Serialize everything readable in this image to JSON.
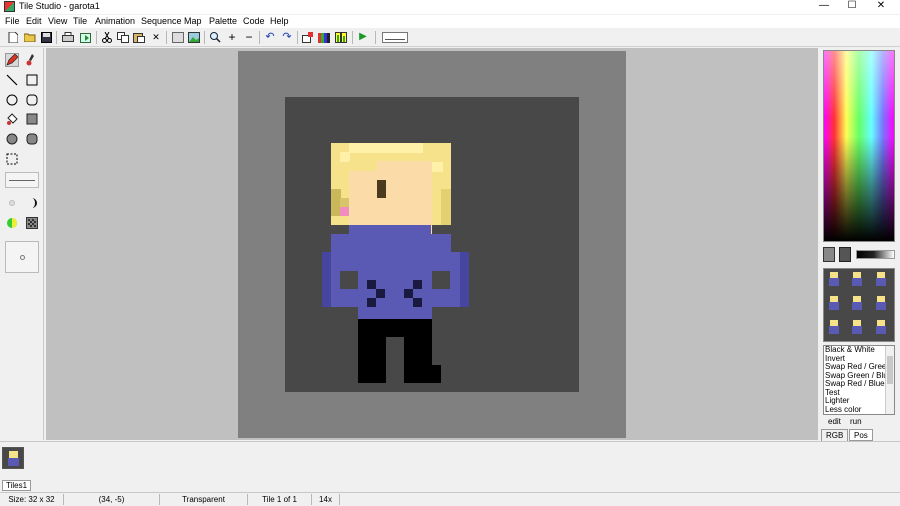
{
  "window": {
    "title": "Tile Studio - garota1",
    "controls": {
      "minimize": "—",
      "maximize": "☐",
      "close": "✕"
    }
  },
  "menu": [
    "File",
    "Edit",
    "View",
    "Tile",
    "Animation",
    "Sequence",
    "Map",
    "Palette",
    "Code",
    "Help"
  ],
  "toolbar": {
    "icons": [
      "new-file-icon",
      "open-folder-icon",
      "save-icon",
      "print-icon",
      "export-icon",
      "cut-icon",
      "copy-icon",
      "paste-icon",
      "delete-icon",
      "clear-icon",
      "import-image-icon",
      "zoom-icon",
      "zoom-in-icon",
      "zoom-out-icon",
      "undo-icon",
      "redo-icon",
      "tile-icon",
      "palette-icon",
      "bars-icon",
      "run-icon"
    ],
    "glyphs": {
      "zoom_in": "+",
      "zoom_out": "−",
      "undo": "↶",
      "redo": "↷",
      "run": "▶",
      "delete": "✕"
    }
  },
  "tools": [
    "pencil",
    "brush",
    "line",
    "rectangle",
    "ellipse",
    "rounded-rectangle",
    "fill",
    "filled-rectangle",
    "filled-ellipse",
    "filled-rounded-rectangle",
    "select",
    "pen-size",
    "soft-brush",
    "light-dark",
    "color-replace",
    "pattern",
    "brush-preview"
  ],
  "colors": {
    "canvas_bg": "#484848",
    "canvas_border": "#808080",
    "workspace": "#c0c0c0",
    "hair": "#f5e28a",
    "hair_light": "#fff2a8",
    "hair_dark": "#c9b75a",
    "skin": "#fbdca8",
    "blush": "#f28cc0",
    "eye": "#4a3a20",
    "shirt": "#5a5ab4",
    "shirt_shadow": "#4646a0",
    "shirt_detail": "#1a1a40",
    "pants": "#000000"
  },
  "palette_filters": {
    "items": [
      "Black & White",
      "Invert",
      "Swap Red / Green",
      "Swap  Green / Blue",
      "Swap Red / Blue",
      "Test",
      "Lighter",
      "Less color"
    ],
    "edit_label": "edit",
    "run_label": "run"
  },
  "tabs": {
    "rgb": "RGB",
    "pos": "Pos"
  },
  "tileset_tab": "Tiles1",
  "status": {
    "size": "Size: 32 x 32",
    "cursor": "(34, -5)",
    "color": "Transparent",
    "tile": "Tile 1 of 1",
    "zoom": "14x"
  }
}
